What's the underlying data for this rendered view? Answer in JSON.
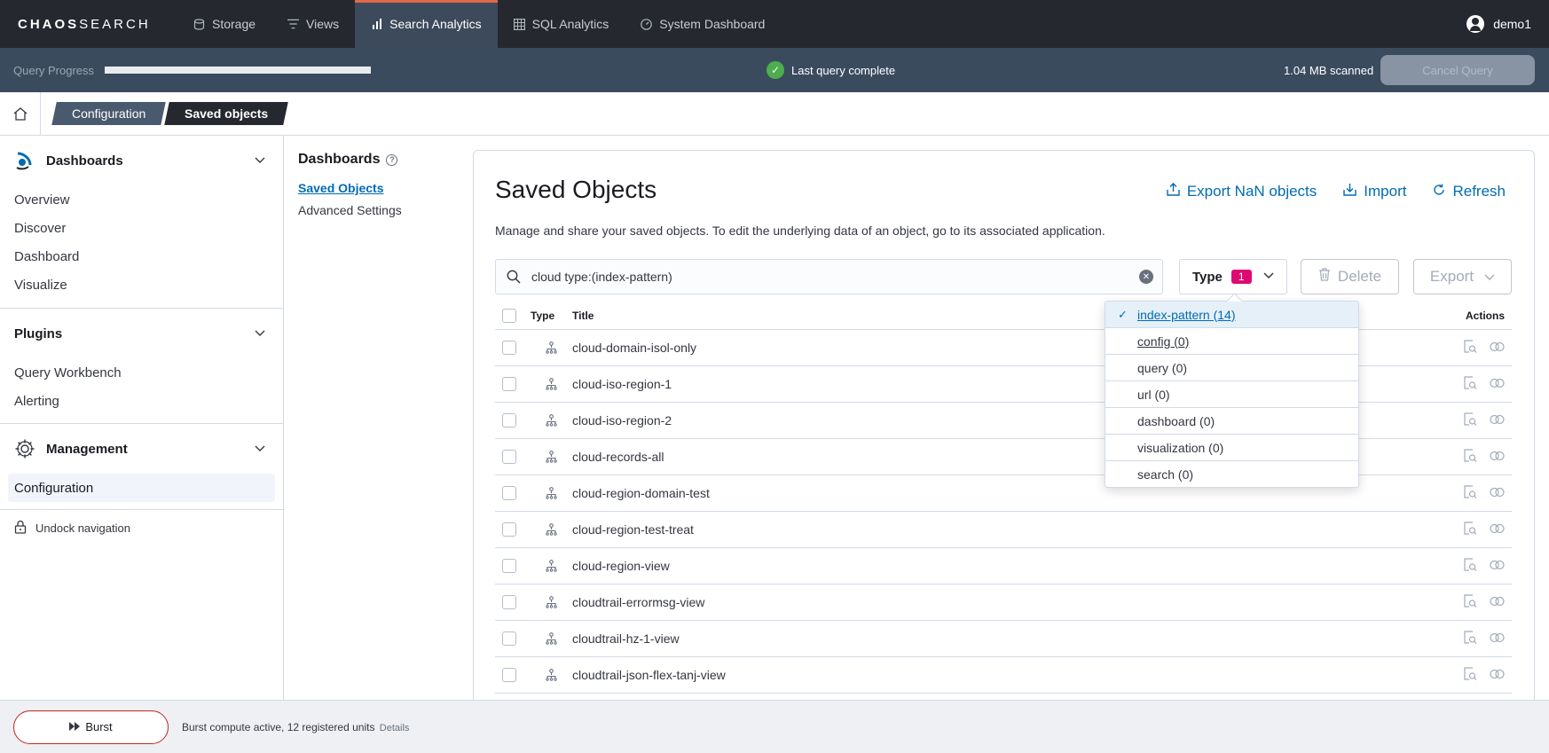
{
  "brand": {
    "logo_a": "CHAOS",
    "logo_b": "SEARCH"
  },
  "nav": {
    "tabs": [
      {
        "label": "Storage",
        "icon": "storage-icon"
      },
      {
        "label": "Views",
        "icon": "filter-icon"
      },
      {
        "label": "Search Analytics",
        "icon": "bar-chart-icon",
        "active": true
      },
      {
        "label": "SQL Analytics",
        "icon": "table-icon"
      },
      {
        "label": "System Dashboard",
        "icon": "dashboard-icon"
      }
    ],
    "user": "demo1"
  },
  "query_bar": {
    "label": "Query Progress",
    "progress": 1.0,
    "status": "Last query complete",
    "scanned": "1.04 MB scanned",
    "cancel": "Cancel Query"
  },
  "breadcrumbs": [
    "Configuration",
    "Saved objects"
  ],
  "sidebar": {
    "groups": [
      {
        "title": "Dashboards",
        "items": [
          "Overview",
          "Discover",
          "Dashboard",
          "Visualize"
        ]
      },
      {
        "title": "Plugins",
        "items": [
          "Query Workbench",
          "Alerting"
        ]
      },
      {
        "title": "Management",
        "items": [
          "Configuration"
        ]
      }
    ],
    "undock": "Undock navigation"
  },
  "subnav": {
    "title": "Dashboards",
    "links": [
      "Saved Objects",
      "Advanced Settings"
    ]
  },
  "main": {
    "title": "Saved Objects",
    "actions": [
      "Export NaN objects",
      "Import",
      "Refresh"
    ],
    "description": "Manage and share your saved objects. To edit the underlying data of an object, go to its associated application.",
    "search_value": "cloud type:(index-pattern)",
    "type_filter": {
      "label": "Type",
      "count": "1"
    },
    "delete": "Delete",
    "export": "Export",
    "columns": {
      "type": "Type",
      "title": "Title",
      "actions": "Actions"
    },
    "rows": [
      "cloud-domain-isol-only",
      "cloud-iso-region-1",
      "cloud-iso-region-2",
      "cloud-records-all",
      "cloud-region-domain-test",
      "cloud-region-test-treat",
      "cloud-region-view",
      "cloudtrail-errormsg-view",
      "cloudtrail-hz-1-view",
      "cloudtrail-json-flex-tanj-view"
    ]
  },
  "type_options": [
    {
      "label": "index-pattern (14)",
      "selected": true
    },
    {
      "label": "config (0)"
    },
    {
      "label": "query (0)"
    },
    {
      "label": "url (0)"
    },
    {
      "label": "dashboard (0)"
    },
    {
      "label": "visualization (0)"
    },
    {
      "label": "search (0)"
    }
  ],
  "footer": {
    "burst": "Burst",
    "text": "Burst compute active, 12 registered units",
    "details": "Details"
  },
  "colors": {
    "accent": "#006bb4",
    "badge": "#dd0a73",
    "nav_bg": "#25282f",
    "qbar_bg": "#3b4b5e"
  }
}
